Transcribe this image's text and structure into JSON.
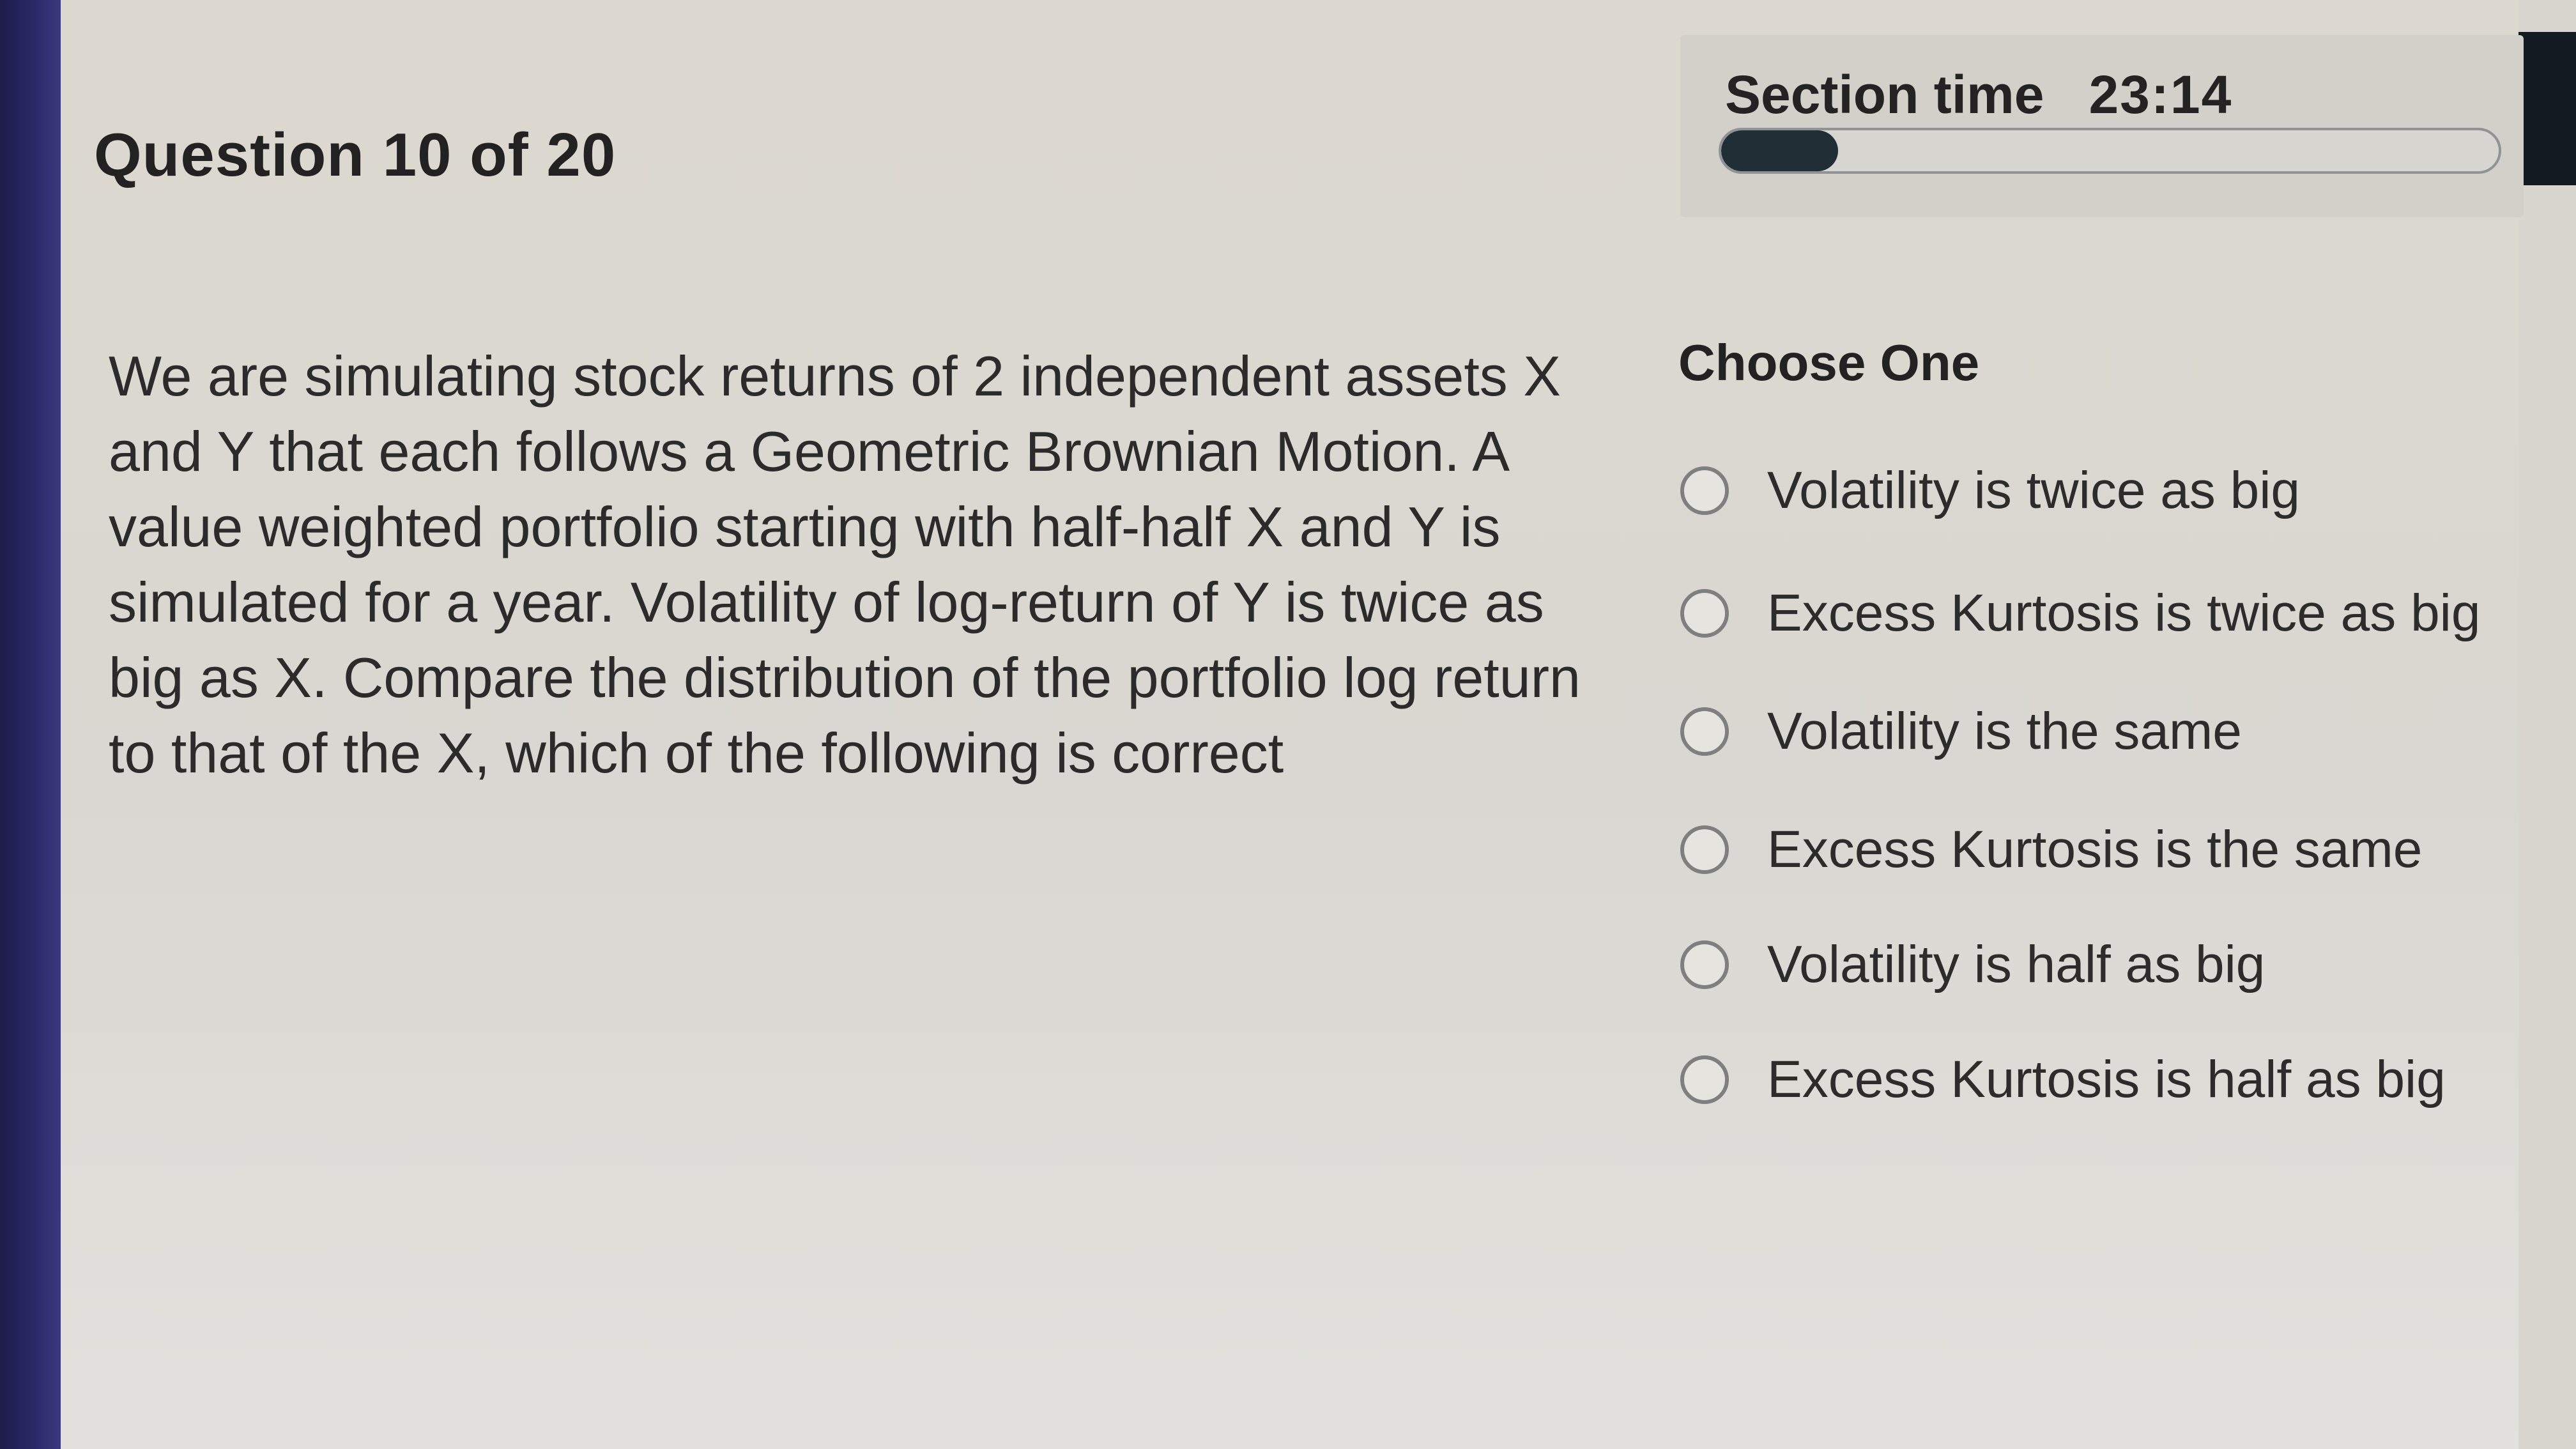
{
  "header": {
    "question_counter": "Question 10 of 20",
    "section_time_label": "Section time",
    "section_time_value": "23:14",
    "time_progress_fraction": 0.15
  },
  "question": {
    "text": "We are simulating stock returns of 2 independent assets X and Y that each follows a Geometric Brownian Motion. A value weighted portfolio starting with half-half X and Y is simulated for a year. Volatility of log-return of Y is twice as big as X. Compare the distribution of the portfolio log return to that of the X, which of the following is correct"
  },
  "answers": {
    "prompt": "Choose One",
    "options": [
      {
        "label": "Volatility is twice as big",
        "selected": false
      },
      {
        "label": "Excess Kurtosis is twice as big",
        "selected": false
      },
      {
        "label": "Volatility is the same",
        "selected": false
      },
      {
        "label": "Excess Kurtosis is the same",
        "selected": false
      },
      {
        "label": "Volatility is half as big",
        "selected": false
      },
      {
        "label": "Excess Kurtosis is half as big",
        "selected": false
      }
    ]
  },
  "colors": {
    "progress_fill": "#1f2f35",
    "progress_border": "#8f9396",
    "background": "#d9d6cf"
  },
  "icons": {
    "radio": "radio-unchecked-icon"
  }
}
